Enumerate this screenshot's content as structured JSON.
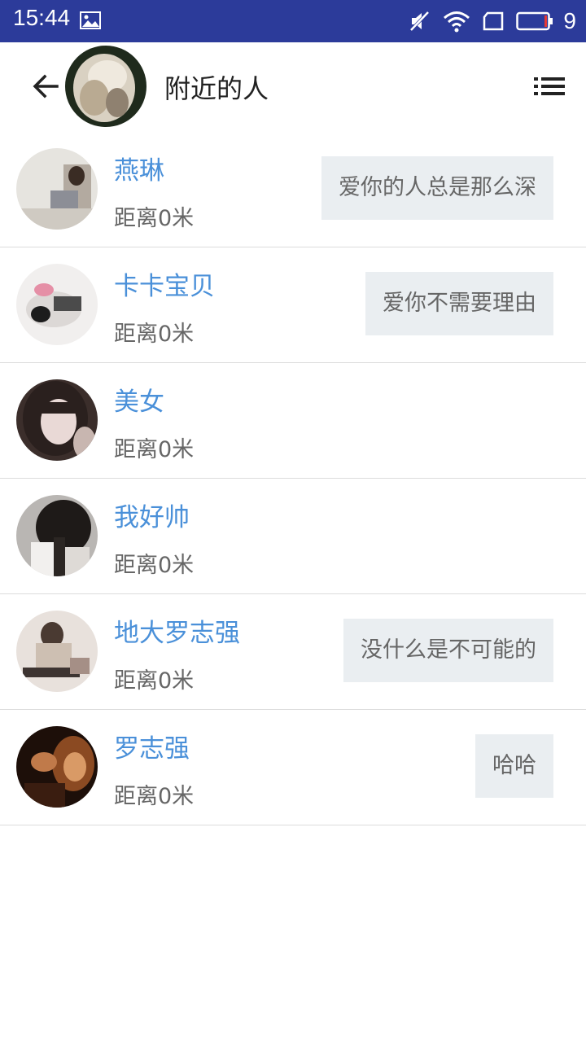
{
  "status_bar": {
    "time": "15:44",
    "battery_level": "9",
    "icons": [
      "image-icon",
      "mute-icon",
      "wifi-icon",
      "sim-icon",
      "battery-icon"
    ]
  },
  "app_bar": {
    "title": "附近的人",
    "back_icon": "arrow-left-icon",
    "menu_icon": "list-icon"
  },
  "people": [
    {
      "name": "燕琳",
      "distance": "距离0米",
      "signature": "爱你的人总是那么深"
    },
    {
      "name": "卡卡宝贝",
      "distance": "距离0米",
      "signature": "爱你不需要理由"
    },
    {
      "name": "美女",
      "distance": "距离0米",
      "signature": ""
    },
    {
      "name": "我好帅",
      "distance": "距离0米",
      "signature": ""
    },
    {
      "name": "地大罗志强",
      "distance": "距离0米",
      "signature": "没什么是不可能的"
    },
    {
      "name": "罗志强",
      "distance": "距离0米",
      "signature": "哈哈"
    }
  ],
  "colors": {
    "status_bar": "#2c3b9a",
    "name_text": "#4a90d9",
    "signature_bg": "#eaeef1",
    "divider": "#dcdcdc"
  }
}
